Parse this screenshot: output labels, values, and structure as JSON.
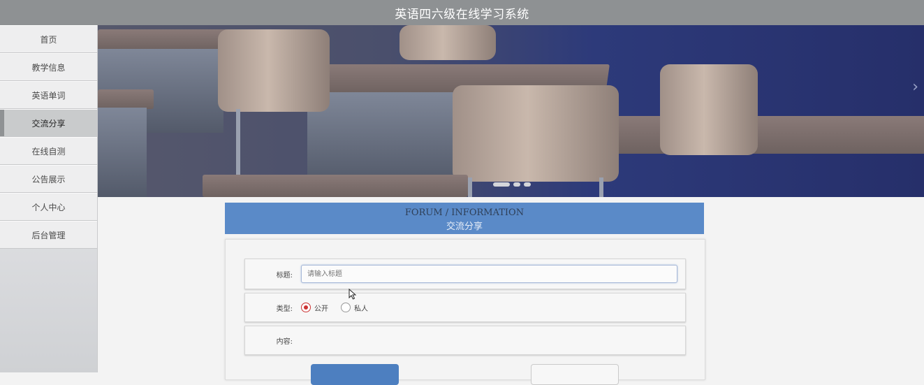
{
  "header": {
    "title": "英语四六级在线学习系统"
  },
  "sidebar": {
    "items": [
      {
        "label": "首页"
      },
      {
        "label": "教学信息"
      },
      {
        "label": "英语单词"
      },
      {
        "label": "交流分享",
        "active": true
      },
      {
        "label": "在线自测"
      },
      {
        "label": "公告展示"
      },
      {
        "label": "个人中心"
      },
      {
        "label": "后台管理"
      }
    ]
  },
  "banner": {
    "image": "classroom-desks-chairs",
    "arrow_right": "›",
    "indicator_count": 3,
    "active_indicator": 1
  },
  "forum": {
    "title_en": "FORUM / INFORMATION",
    "title_zh": "交流分享"
  },
  "form": {
    "title_label": "标题:",
    "title_placeholder": "请输入标题",
    "title_value": "",
    "type_label": "类型:",
    "type_options": [
      "公开",
      "私人"
    ],
    "type_selected": "公开",
    "content_label": "内容:"
  },
  "colors": {
    "topbar": "#8e9193",
    "forum_header": "#5a8ac8",
    "submit_button": "#4d7fc0",
    "radio_checked": "#cc3333"
  }
}
